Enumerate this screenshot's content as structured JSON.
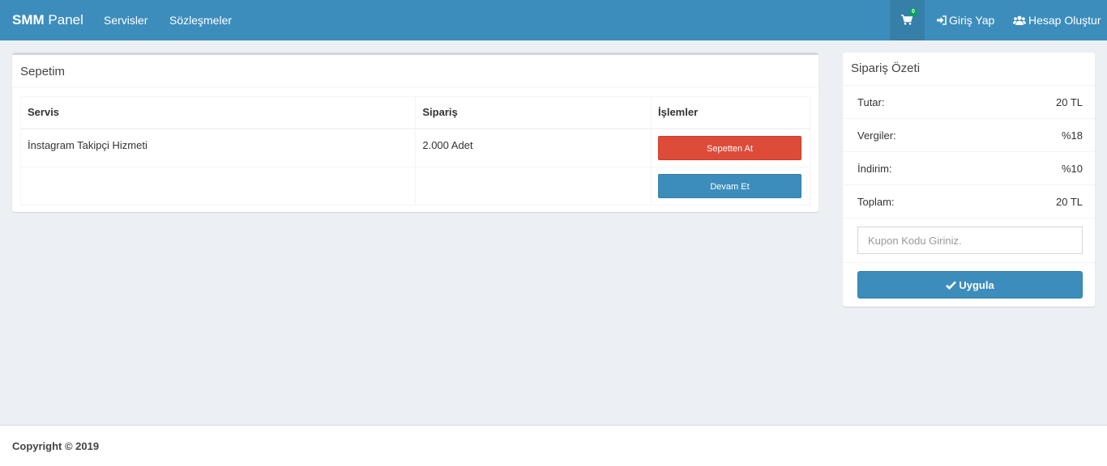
{
  "navbar": {
    "brand_bold": "SMM",
    "brand_rest": " Panel",
    "links": [
      "Servisler",
      "Sözleşmeler"
    ],
    "cart_count": "0",
    "login_label": "Giriş Yap",
    "register_label": "Hesap Oluştur"
  },
  "cart": {
    "title": "Sepetim",
    "columns": [
      "Servis",
      "Sipariş",
      "İşlemler"
    ],
    "rows": [
      {
        "service": "İnstagram Takipçi Hizmeti",
        "order": "2.000 Adet",
        "action": "Sepetten At"
      }
    ],
    "continue_label": "Devam Et"
  },
  "summary": {
    "title": "Sipariş Özeti",
    "items": [
      {
        "label": "Tutar:",
        "value": "20 TL"
      },
      {
        "label": "Vergiler:",
        "value": "%18"
      },
      {
        "label": "İndirim:",
        "value": "%10"
      },
      {
        "label": "Toplam:",
        "value": "20 TL"
      }
    ],
    "coupon_placeholder": "Kupon Kodu Giriniz.",
    "apply_label": "Uygula"
  },
  "footer": {
    "text": "Copyright © 2019"
  },
  "colors": {
    "primary": "#3c8dbc",
    "danger": "#dd4b39",
    "badge": "#00a65a",
    "background": "#ecf0f5"
  },
  "icons": [
    "shopping-cart-icon",
    "sign-in-icon",
    "users-icon",
    "check-icon"
  ]
}
